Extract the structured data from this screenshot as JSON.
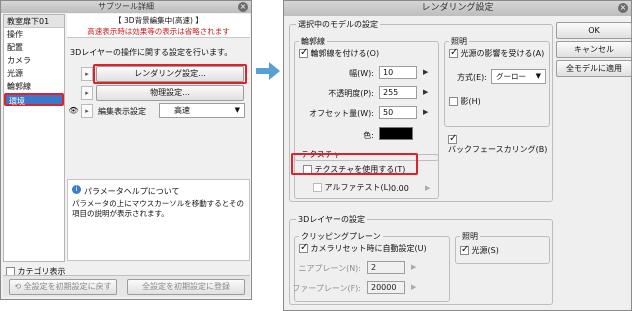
{
  "subtool": {
    "title": "サブツール詳細",
    "tool_name": "教室扉下01",
    "category_items": [
      "操作",
      "配置",
      "カメラ",
      "光源",
      "輪郭線",
      "環境"
    ],
    "selected_category": "環境",
    "banner_title": "【 3D背景編集中(高速) 】",
    "banner_warning": "高速表示時は効果等の表示は省略されます",
    "description": "3Dレイヤーの操作に関する設定を行います。",
    "render_button": "レンダリング設定...",
    "physics_button": "物理設定...",
    "edit_display_label": "編集表示設定",
    "edit_display_value": "高速",
    "help_title": "パラメータヘルプについて",
    "help_text": "パラメータの上にマウスカーソルを移動するとその項目の説明が表示されます。",
    "category_display_label": "カテゴリ表示",
    "reset_all_button": "全設定を初期設定に戻す",
    "register_all_button": "全設定を初期設定に登録"
  },
  "dialog": {
    "title": "レンダリング設定",
    "model_group_title": "選択中のモデルの設定",
    "outline": {
      "title": "輪郭線",
      "enable_label": "輪郭線を付ける(O)",
      "enable_checked": true,
      "width_label": "幅(W):",
      "width_value": "10",
      "opacity_label": "不透明度(P):",
      "opacity_value": "255",
      "offset_label": "オフセット量(W):",
      "offset_value": "50",
      "color_label": "色:",
      "color": "#000000"
    },
    "lighting": {
      "title": "照明",
      "light_label": "光源の影響を受ける(A)",
      "light_checked": true,
      "method_label": "方式(E):",
      "method_value": "グーロー",
      "shadow_label": "影(H)",
      "shadow_checked": false
    },
    "backface_label": "バックフェースカリング(B)",
    "backface_checked": true,
    "texture": {
      "title": "テクスチャ",
      "use_label": "テクスチャを使用する(T)",
      "use_checked": false,
      "alpha_label": "アルファテスト(L)",
      "alpha_value": "0.00"
    },
    "layer_group_title": "3Dレイヤーの設定",
    "clipping": {
      "title": "クリッピングプレーン",
      "auto_label": "カメラリセット時に自動設定(U)",
      "auto_checked": true,
      "near_label": "ニアプレーン(N):",
      "near_value": "2",
      "far_label": "ファープレーン(F):",
      "far_value": "20000"
    },
    "layer_lighting": {
      "title": "照明",
      "light_label": "光源(S)",
      "light_checked": true
    },
    "ok_button": "OK",
    "cancel_button": "キャンセル",
    "apply_all_button": "全モデルに適用"
  },
  "colors": {
    "highlight": "#e0202a",
    "arrow": "#5a9fd4",
    "selection": "#3b78c9",
    "warning_text": "#d21a1a"
  }
}
